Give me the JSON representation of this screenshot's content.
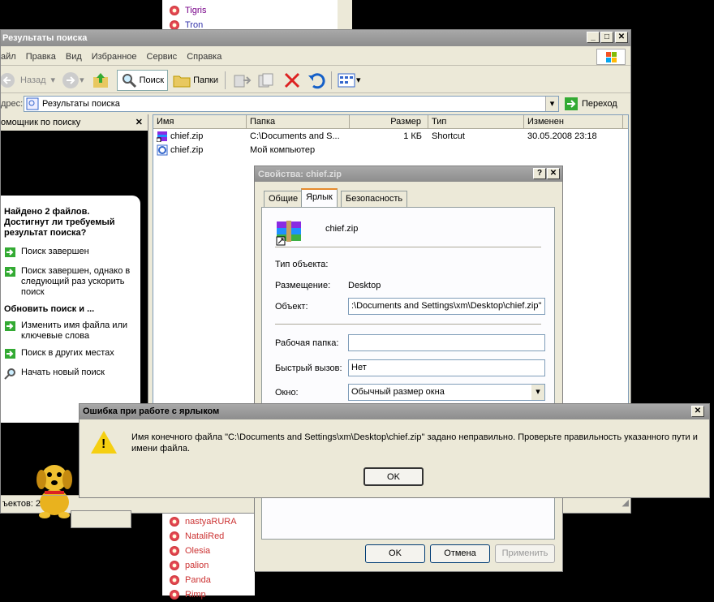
{
  "buddy_top": [
    "Tigris",
    "Tron"
  ],
  "buddy_bottom": [
    "nastyaRURA",
    "NataliRed",
    "Olesia",
    "palion",
    "Panda",
    "Rimp"
  ],
  "explorer": {
    "title": "Результаты поиска",
    "menu": [
      "айл",
      "Правка",
      "Вид",
      "Избранное",
      "Сервис",
      "Справка"
    ],
    "toolbar": {
      "back": "Назад",
      "search": "Поиск",
      "folders": "Папки"
    },
    "address_label": "дрес:",
    "address_value": "Результаты поиска",
    "go": "Переход",
    "columns": [
      "Имя",
      "Папка",
      "Размер",
      "Тип",
      "Изменен"
    ],
    "rows": [
      {
        "name": "chief.zip",
        "folder": "C:\\Documents and S...",
        "size": "1 КБ",
        "type": "Shortcut",
        "modified": "30.05.2008 23:18"
      },
      {
        "name": "chief.zip",
        "folder": "Мой компьютер",
        "size": "",
        "type": "",
        "modified": ""
      }
    ],
    "status": "ъектов: 2"
  },
  "assistant": {
    "header": "омощник по поиску",
    "close": "✕",
    "found_title": "Найдено 2 файлов. Достигнут ли требуемый результат поиска?",
    "opt1": "Поиск завершен",
    "opt2": "Поиск завершен, однако в следующий раз ускорить поиск",
    "refresh_title": "Обновить поиск и ...",
    "opt3": "Изменить имя файла или ключевые слова",
    "opt4": "Поиск в других местах",
    "opt5": "Начать новый поиск"
  },
  "props": {
    "title": "Свойства: chief.zip",
    "tabs": [
      "Общие",
      "Ярлык",
      "Безопасность"
    ],
    "filename": "chief.zip",
    "type_label": "Тип объекта:",
    "location_label": "Размещение:",
    "location_value": "Desktop",
    "target_label": "Объект:",
    "target_value": ":\\Documents and Settings\\xm\\Desktop\\chief.zip\"",
    "workdir_label": "Рабочая папка:",
    "hotkey_label": "Быстрый вызов:",
    "hotkey_value": "Нет",
    "window_label": "Окно:",
    "window_value": "Обычный размер окна",
    "ok": "OK",
    "cancel": "Отмена",
    "apply": "Применить"
  },
  "error": {
    "title": "Ошибка при работе с ярлыком",
    "message": "Имя конечного файла \"C:\\Documents and Settings\\xm\\Desktop\\chief.zip\" задано неправильно. Проверьте правильность указанного пути и имени файла.",
    "ok": "OK"
  }
}
